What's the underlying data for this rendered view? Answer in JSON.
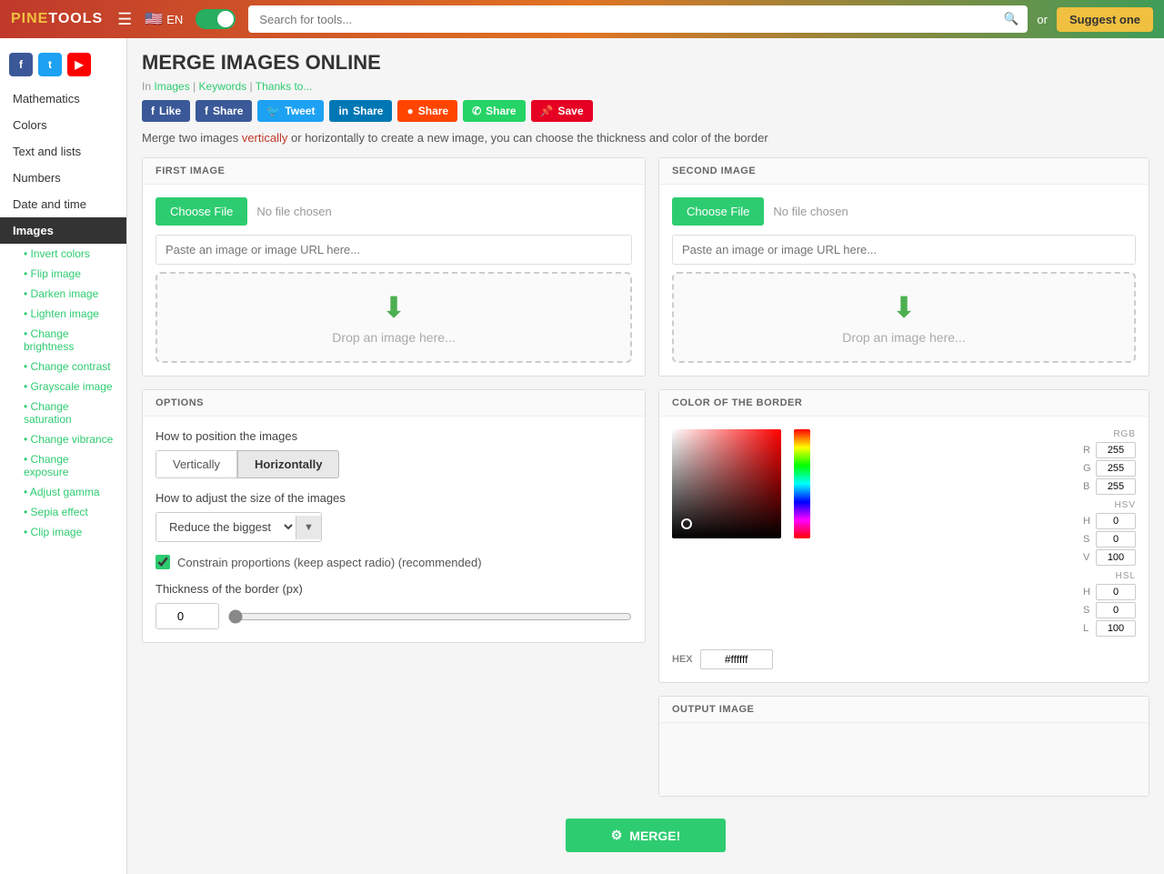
{
  "nav": {
    "logo_pine": "PINE",
    "logo_tools": "TOOLS",
    "hamburger": "☰",
    "lang": "EN",
    "search_placeholder": "Search for tools...",
    "suggest_label": "Suggest one"
  },
  "sidebar": {
    "social": [
      "f",
      "t",
      "▶"
    ],
    "items": [
      {
        "label": "Mathematics",
        "active": false
      },
      {
        "label": "Colors",
        "active": false
      },
      {
        "label": "Text and lists",
        "active": false
      },
      {
        "label": "Numbers",
        "active": false
      },
      {
        "label": "Date and time",
        "active": false
      },
      {
        "label": "Images",
        "active": true
      }
    ],
    "sub_items": [
      "Invert colors",
      "Flip image",
      "Darken image",
      "Lighten image",
      "Change brightness",
      "Change contrast",
      "Grayscale image",
      "Change saturation",
      "Change vibrance",
      "Change exposure",
      "Adjust gamma",
      "Sepia effect",
      "Clip image"
    ]
  },
  "page": {
    "title": "MERGE IMAGES ONLINE",
    "breadcrumb_in": "In",
    "breadcrumb_images": "Images",
    "breadcrumb_sep1": "|",
    "breadcrumb_keywords": "Keywords",
    "breadcrumb_sep2": "|",
    "breadcrumb_thanks": "Thanks to...",
    "description": "Merge two images vertically or horizontally to create a new image, you can choose the thickness and color of the border"
  },
  "share": {
    "buttons": [
      {
        "label": "Like",
        "class": "sb-like"
      },
      {
        "label": "Share",
        "class": "sb-share-fb"
      },
      {
        "label": "Tweet",
        "class": "sb-tweet"
      },
      {
        "label": "Share",
        "class": "sb-share-li"
      },
      {
        "label": "Share",
        "class": "sb-share-rd"
      },
      {
        "label": "Share",
        "class": "sb-share-wa"
      },
      {
        "label": "Save",
        "class": "sb-save"
      }
    ]
  },
  "first_image": {
    "header": "FIRST IMAGE",
    "choose_label": "Choose File",
    "no_file": "No file chosen",
    "url_placeholder": "Paste an image or image URL here...",
    "drop_text": "Drop an image here..."
  },
  "second_image": {
    "header": "SECOND IMAGE",
    "choose_label": "Choose File",
    "no_file": "No file chosen",
    "url_placeholder": "Paste an image or image URL here...",
    "drop_text": "Drop an image here..."
  },
  "options": {
    "header": "OPTIONS",
    "position_label": "How to position the images",
    "btn_vertical": "Vertically",
    "btn_horizontal": "Horizontally",
    "size_label": "How to adjust the size of the images",
    "size_options": [
      "Reduce the biggest"
    ],
    "constrain_label": "Constrain proportions (keep aspect radio) (recommended)",
    "thickness_label": "Thickness of the border (px)",
    "thickness_value": "0"
  },
  "color_border": {
    "header": "COLOR OF THE BORDER",
    "hex_label": "HEX",
    "hex_value": "#ffffff",
    "rgb_title": "RGB",
    "r": "255",
    "g": "255",
    "b": "255",
    "hsv_title": "HSV",
    "hsv_h": "0",
    "hsv_s": "0",
    "hsv_v": "100",
    "hsl_title": "HSL",
    "hsl_h": "0",
    "hsl_s": "0",
    "hsl_l": "100"
  },
  "output": {
    "header": "OUTPUT IMAGE"
  },
  "merge_btn": "MERGE!"
}
